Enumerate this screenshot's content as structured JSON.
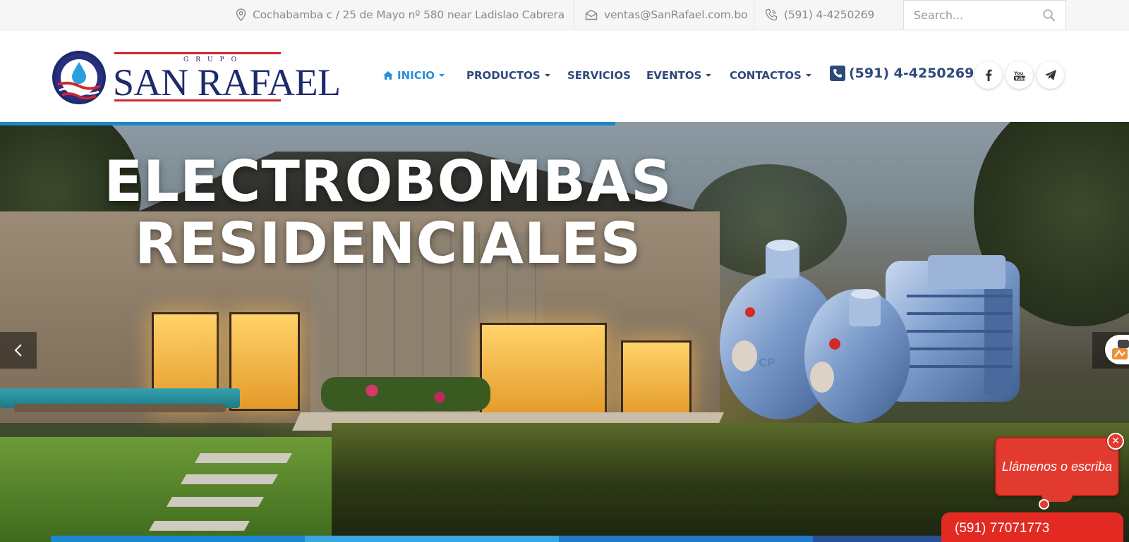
{
  "topbar": {
    "address": "Cochabamba c / 25 de Mayo nº 580 near Ladislao Cabrera",
    "email": "ventas@SanRafael.com.bo",
    "phone": "(591) 4-4250269",
    "search_placeholder": "Search...",
    "icons": [
      "location-pin-icon",
      "envelope-icon",
      "phone-icon",
      "search-icon"
    ]
  },
  "logo": {
    "small_text": "GRUPO",
    "big_text": "SAN RAFAEL",
    "colors": {
      "navy": "#1d2a6b",
      "red": "#d4262f"
    }
  },
  "nav": {
    "items": [
      {
        "label": "INICIO",
        "active": true,
        "dropdown": true,
        "icon": "home-icon"
      },
      {
        "label": "PRODUCTOS",
        "active": false,
        "dropdown": true
      },
      {
        "label": "SERVICIOS",
        "active": false,
        "dropdown": false
      },
      {
        "label": "EVENTOS",
        "active": false,
        "dropdown": true
      },
      {
        "label": "CONTACTOS",
        "active": false,
        "dropdown": true
      }
    ],
    "phone": "(591) 4-4250269",
    "social": [
      "facebook-icon",
      "youtube-icon",
      "telegram-icon"
    ],
    "colors": {
      "active": "#2a8fd6",
      "default": "#2e4a7a"
    }
  },
  "hero": {
    "title_line1": "ELECTROBOMBAS",
    "title_line2": "RESIDENCIALES",
    "slide_progress": 0.545,
    "progress_color": "#1a87d0"
  },
  "contact_widget": {
    "bubble_text": "Llámenos o escriba",
    "close_label": "✕",
    "phone": "(591) 77071773",
    "color": "#e23a2e"
  }
}
